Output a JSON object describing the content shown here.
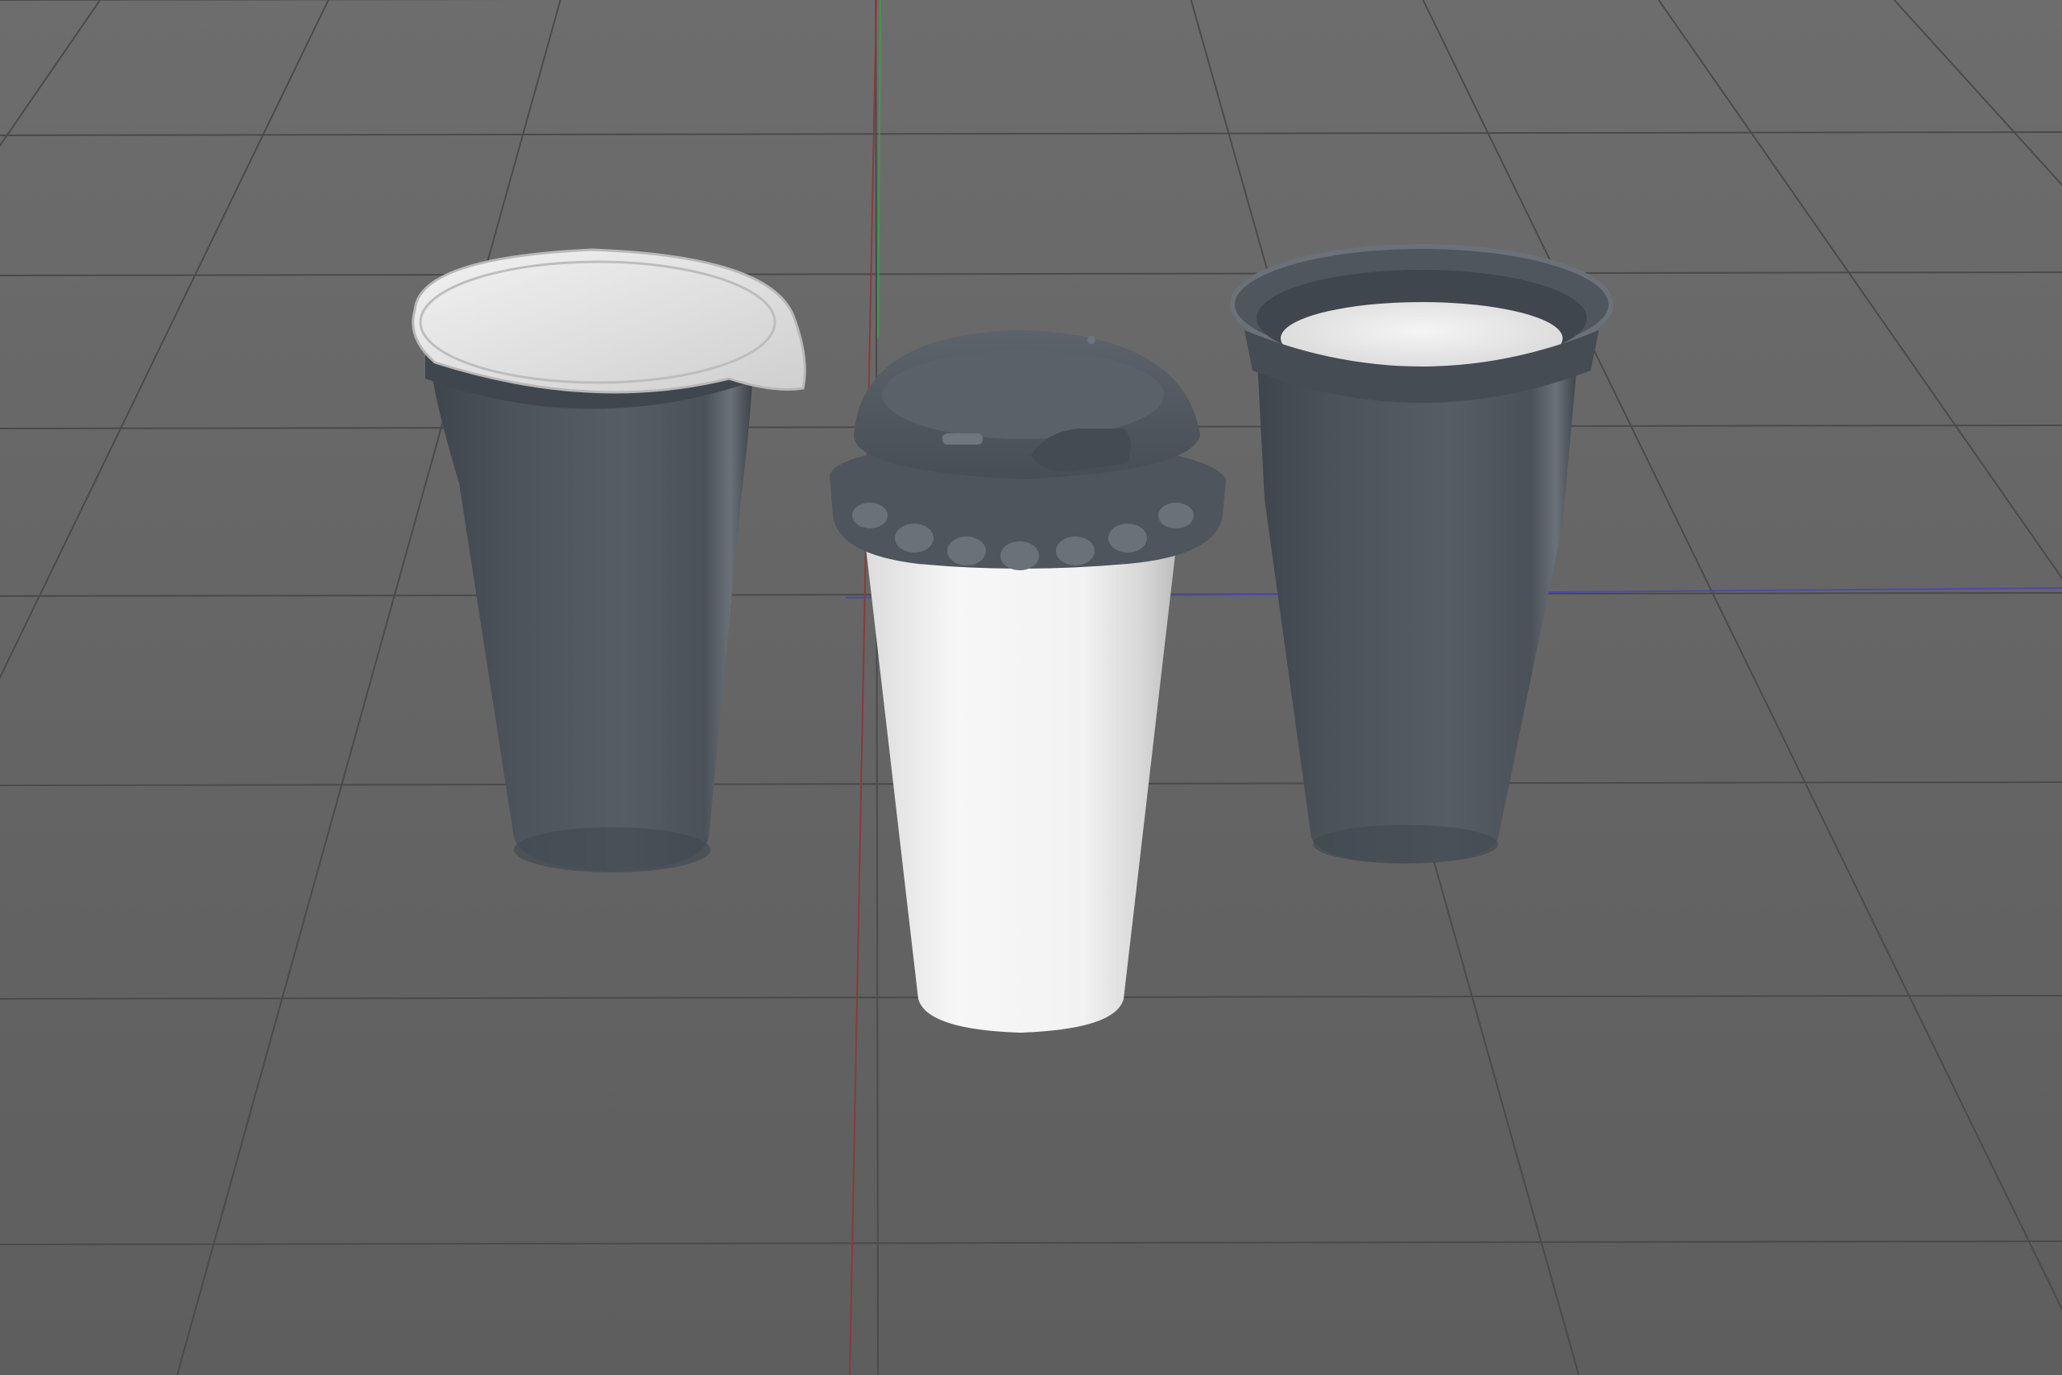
{
  "viewport": {
    "background": "#666666",
    "grid_color": "#4a4a4a",
    "axis_x_color": "#8a3a3a",
    "axis_y_color": "#3f9a4a",
    "axis_z_color": "#4a4ab0"
  },
  "objects": [
    {
      "name": "sealed-cup",
      "body_color": "#4d545c",
      "lid_color": "#e4e4e4"
    },
    {
      "name": "coffee-cup-with-lid",
      "body_color": "#f1f1f1",
      "lid_color": "#535a62"
    },
    {
      "name": "open-cup",
      "body_color": "#4d545c",
      "fill_color": "#e8e8e8"
    }
  ]
}
